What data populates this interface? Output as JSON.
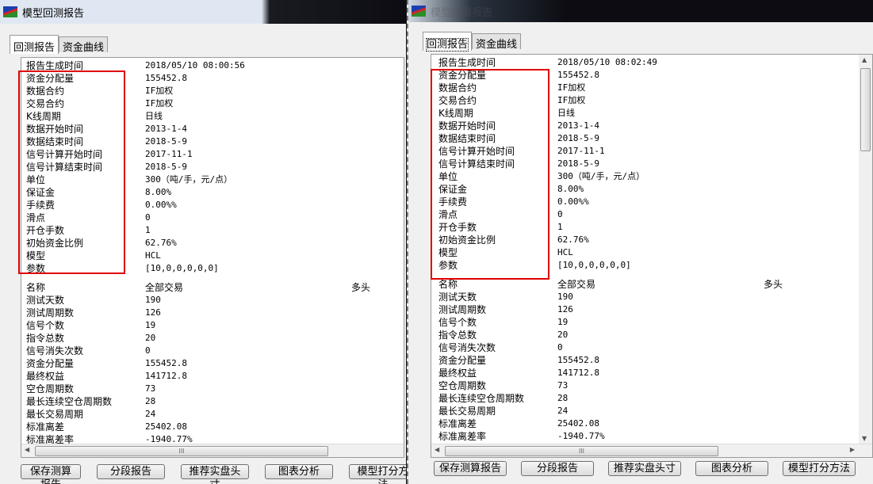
{
  "windows": [
    {
      "title": "模型回测报告",
      "tabs": [
        "回测报告",
        "资金曲线"
      ],
      "settings": [
        [
          "报告生成时间",
          "2018/05/10 08:00:56"
        ],
        [
          "资金分配量",
          "155452.8"
        ],
        [
          "数据合约",
          "IF加权"
        ],
        [
          "交易合约",
          "IF加权"
        ],
        [
          "K线周期",
          "日线"
        ],
        [
          "数据开始时间",
          "2013-1-4"
        ],
        [
          "数据结束时间",
          "2018-5-9"
        ],
        [
          "信号计算开始时间",
          "2017-11-1"
        ],
        [
          "信号计算结束时间",
          "2018-5-9"
        ],
        [
          "单位",
          "300（吨/手，元/点）"
        ],
        [
          "保证金",
          "8.00%"
        ],
        [
          "手续费",
          "0.00%%"
        ],
        [
          "滑点",
          "0"
        ],
        [
          "开仓手数",
          "1"
        ],
        [
          "初始资金比例",
          "62.76%"
        ],
        [
          "模型",
          "HCL"
        ],
        [
          "参数",
          "[10,0,0,0,0,0]"
        ]
      ],
      "stats_header": [
        "名称",
        "全部交易",
        "多头"
      ],
      "stats": [
        [
          "测试天数",
          "190"
        ],
        [
          "测试周期数",
          "126"
        ],
        [
          "信号个数",
          "19"
        ],
        [
          "指令总数",
          "20"
        ],
        [
          "信号消失次数",
          "0"
        ],
        [
          "资金分配量",
          "155452.8"
        ],
        [
          "最终权益",
          "141712.8"
        ],
        [
          "空仓周期数",
          "73"
        ],
        [
          "最长连续空仓周期数",
          "28"
        ],
        [
          "最长交易周期",
          "24"
        ],
        [
          "标准离差",
          "25402.08"
        ],
        [
          "标准离差率",
          "-1940.77%"
        ]
      ],
      "buttons": [
        "保存测算报告",
        "分段报告",
        "推荐实盘头寸",
        "图表分析",
        "模型打分方法"
      ]
    },
    {
      "title": "模型回测报告",
      "tabs": [
        "回测报告",
        "资金曲线"
      ],
      "settings": [
        [
          "报告生成时间",
          "2018/05/10 08:02:49"
        ],
        [
          "资金分配量",
          "155452.8"
        ],
        [
          "数据合约",
          "IF加权"
        ],
        [
          "交易合约",
          "IF加权"
        ],
        [
          "K线周期",
          "日线"
        ],
        [
          "数据开始时间",
          "2013-1-4"
        ],
        [
          "数据结束时间",
          "2018-5-9"
        ],
        [
          "信号计算开始时间",
          "2017-11-1"
        ],
        [
          "信号计算结束时间",
          "2018-5-9"
        ],
        [
          "单位",
          "300（吨/手，元/点）"
        ],
        [
          "保证金",
          "8.00%"
        ],
        [
          "手续费",
          "0.00%%"
        ],
        [
          "滑点",
          "0"
        ],
        [
          "开仓手数",
          "1"
        ],
        [
          "初始资金比例",
          "62.76%"
        ],
        [
          "模型",
          "HCL"
        ],
        [
          "参数",
          "[10,0,0,0,0,0]"
        ]
      ],
      "stats_header": [
        "名称",
        "全部交易",
        "多头"
      ],
      "stats": [
        [
          "测试天数",
          "190"
        ],
        [
          "测试周期数",
          "126"
        ],
        [
          "信号个数",
          "19"
        ],
        [
          "指令总数",
          "20"
        ],
        [
          "信号消失次数",
          "0"
        ],
        [
          "资金分配量",
          "155452.8"
        ],
        [
          "最终权益",
          "141712.8"
        ],
        [
          "空仓周期数",
          "73"
        ],
        [
          "最长连续空仓周期数",
          "28"
        ],
        [
          "最长交易周期",
          "24"
        ],
        [
          "标准离差",
          "25402.08"
        ],
        [
          "标准离差率",
          "-1940.77%"
        ]
      ],
      "buttons": [
        "保存测算报告",
        "分段报告",
        "推荐实盘头寸",
        "图表分析",
        "模型打分方法"
      ]
    }
  ],
  "colors": {
    "highlight_box": "#e00000"
  }
}
